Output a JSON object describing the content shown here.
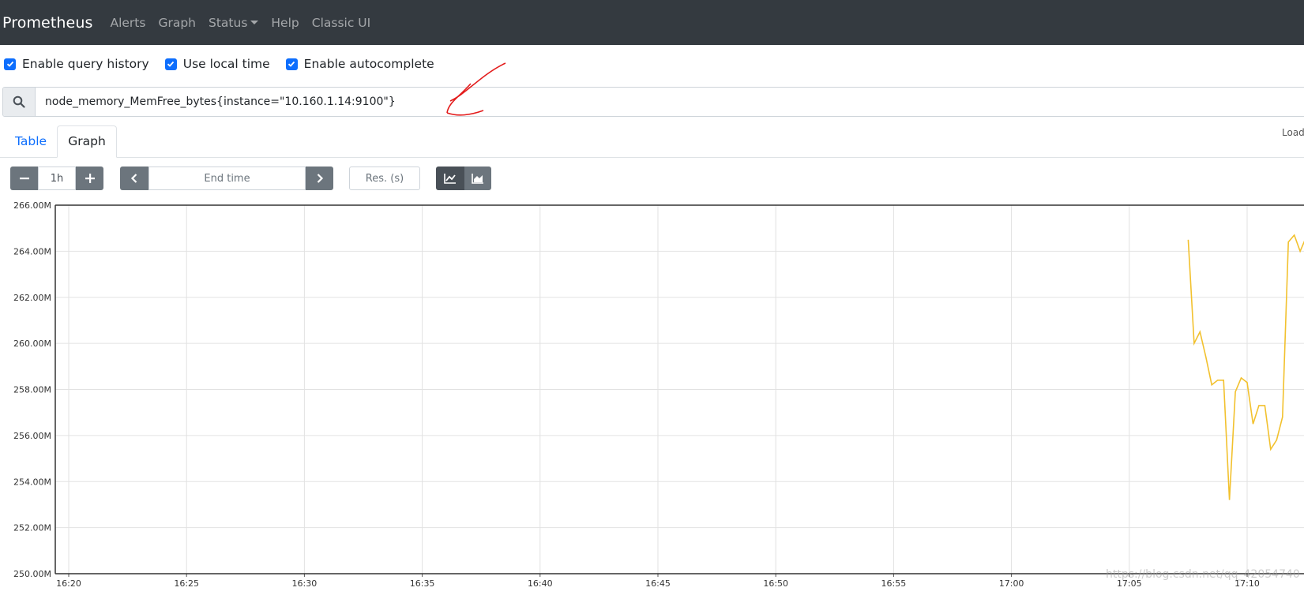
{
  "navbar": {
    "brand": "Prometheus",
    "links": [
      "Alerts",
      "Graph",
      "Status",
      "Help",
      "Classic UI"
    ]
  },
  "options": [
    {
      "label": "Enable query history",
      "checked": true
    },
    {
      "label": "Use local time",
      "checked": true
    },
    {
      "label": "Enable autocomplete",
      "checked": true
    }
  ],
  "query": {
    "value": "node_memory_MemFree_bytes{instance=\"10.160.1.14:9100\"}",
    "icon": "search-icon"
  },
  "load_label": "Load",
  "tabs": [
    "Table",
    "Graph"
  ],
  "active_tab": "Graph",
  "controls": {
    "range": "1h",
    "end_time_placeholder": "End time",
    "resolution_placeholder": "Res. (s)"
  },
  "colors": {
    "navbar": "#343a40",
    "accent": "#0d6efd",
    "series": "#f2c12e"
  },
  "watermark": "https://blog.csdn.net/qq_42054740",
  "chart_data": {
    "type": "line",
    "ylim": [
      250,
      266
    ],
    "y_ticks": [
      "266.00M",
      "264.00M",
      "262.00M",
      "260.00M",
      "258.00M",
      "256.00M",
      "254.00M",
      "252.00M",
      "250.00M"
    ],
    "x_ticks": [
      "16:20",
      "16:25",
      "16:30",
      "16:35",
      "16:40",
      "16:45",
      "16:50",
      "16:55",
      "17:00",
      "17:05",
      "17:10"
    ],
    "series": [
      {
        "x": [
          "17:07:30",
          "17:07:45",
          "17:08:00",
          "17:08:15",
          "17:08:30",
          "17:08:45",
          "17:09:00",
          "17:09:15",
          "17:09:30",
          "17:09:45",
          "17:10:00",
          "17:10:15",
          "17:10:30",
          "17:10:45",
          "17:11:00",
          "17:11:15",
          "17:11:30",
          "17:11:45",
          "17:12:00",
          "17:12:15",
          "17:12:30"
        ],
        "values": [
          264.5,
          260.0,
          260.5,
          259.4,
          258.2,
          258.4,
          258.4,
          253.2,
          257.9,
          258.5,
          258.3,
          256.5,
          257.3,
          257.3,
          255.4,
          255.8,
          256.8,
          264.4,
          264.7,
          264.0,
          264.6
        ]
      }
    ]
  }
}
